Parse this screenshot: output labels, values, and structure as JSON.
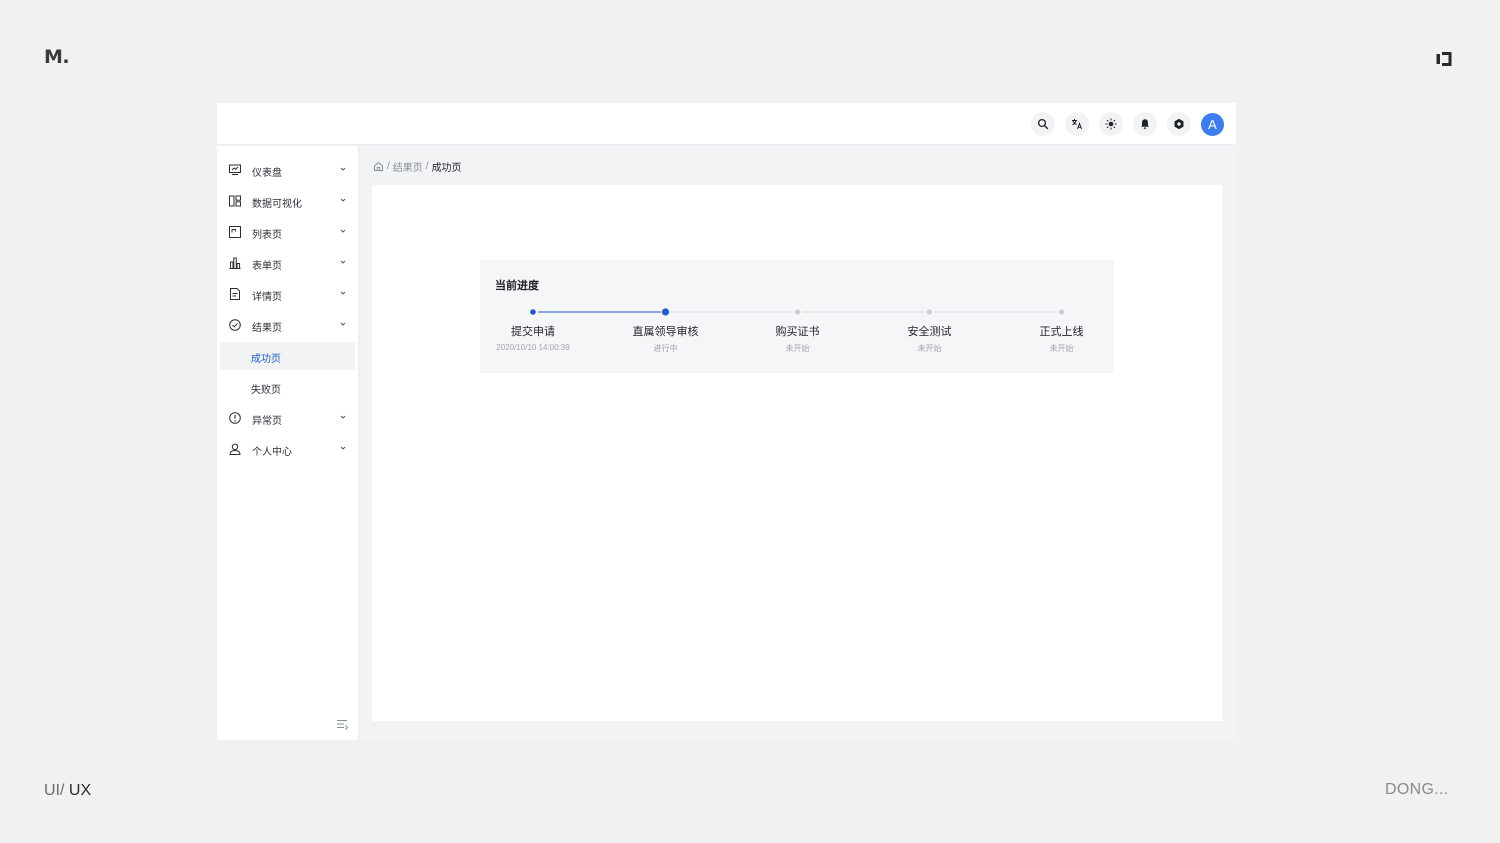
{
  "brand": {
    "logo": "M."
  },
  "footer": {
    "left_prefix": "UI/",
    "left_main": "UX",
    "right": "DONG..."
  },
  "navbar": {
    "icons": [
      "search-icon",
      "translate-icon",
      "theme-icon",
      "notification-icon",
      "settings-icon"
    ],
    "avatar_letter": "A"
  },
  "sidebar": {
    "items": [
      {
        "label": "仪表盘",
        "icon": "dashboard-icon"
      },
      {
        "label": "数据可视化",
        "icon": "data-visualization-icon"
      },
      {
        "label": "列表页",
        "icon": "list-page-icon"
      },
      {
        "label": "表单页",
        "icon": "form-page-icon"
      },
      {
        "label": "详情页",
        "icon": "detail-page-icon"
      },
      {
        "label": "结果页",
        "icon": "result-page-icon"
      },
      {
        "label": "成功页"
      },
      {
        "label": "失败页"
      },
      {
        "label": "异常页",
        "icon": "exception-page-icon"
      },
      {
        "label": "个人中心",
        "icon": "user-center-icon"
      }
    ]
  },
  "breadcrumb": {
    "parent": "结果页",
    "current": "成功页",
    "separator": "/"
  },
  "progress": {
    "title": "当前进度",
    "steps": [
      {
        "title": "提交申请",
        "desc": "2020/10/10 14:00:39",
        "status": "finished"
      },
      {
        "title": "直属领导审核",
        "desc": "进行中",
        "status": "process"
      },
      {
        "title": "购买证书",
        "desc": "未开始",
        "status": "wait"
      },
      {
        "title": "安全测试",
        "desc": "未开始",
        "status": "wait"
      },
      {
        "title": "正式上线",
        "desc": "未开始",
        "status": "wait"
      }
    ]
  },
  "colors": {
    "accent": "#1f5ccf",
    "avatar": "#3c7ef0",
    "page_bg": "#f1f1f1"
  }
}
